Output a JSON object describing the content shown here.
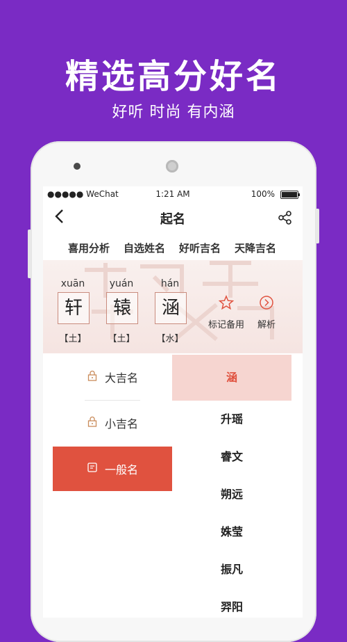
{
  "promo": {
    "headline": "精选高分好名",
    "subline": "好听 时尚 有内涵"
  },
  "statusbar": {
    "carrier": "●●●●● WeChat",
    "time": "1:21 AM",
    "battery": "100%"
  },
  "navbar": {
    "title": "起名",
    "back_icon": "chevron-left-icon",
    "share_icon": "share-icon"
  },
  "tabs": [
    {
      "label": "喜用分析",
      "active": false
    },
    {
      "label": "自选姓名",
      "active": true
    },
    {
      "label": "好听吉名",
      "active": false
    },
    {
      "label": "天降吉名",
      "active": false
    }
  ],
  "hero": {
    "chars": [
      {
        "pinyin": "xuān",
        "char": "轩",
        "element": "【土】"
      },
      {
        "pinyin": "yuán",
        "char": "辕",
        "element": "【土】"
      },
      {
        "pinyin": "hán",
        "char": "涵",
        "element": "【水】"
      }
    ],
    "actions": [
      {
        "label": "标记备用",
        "icon": "star-icon"
      },
      {
        "label": "解析",
        "icon": "chevron-right-circle-icon"
      }
    ]
  },
  "categories": [
    {
      "label": "大吉名",
      "icon": "lock-icon",
      "active": false
    },
    {
      "label": "小吉名",
      "icon": "lock-icon",
      "active": false
    },
    {
      "label": "一般名",
      "icon": "note-icon",
      "active": true
    }
  ],
  "names": [
    {
      "label": "涵",
      "active": true
    },
    {
      "label": "升瑶",
      "active": false
    },
    {
      "label": "睿文",
      "active": false
    },
    {
      "label": "朔远",
      "active": false
    },
    {
      "label": "姝莹",
      "active": false
    },
    {
      "label": "振凡",
      "active": false
    },
    {
      "label": "羿阳",
      "active": false
    }
  ],
  "colors": {
    "background": "#7a2bc4",
    "accent": "#e0523f",
    "accent_light": "#f6d5d0"
  }
}
